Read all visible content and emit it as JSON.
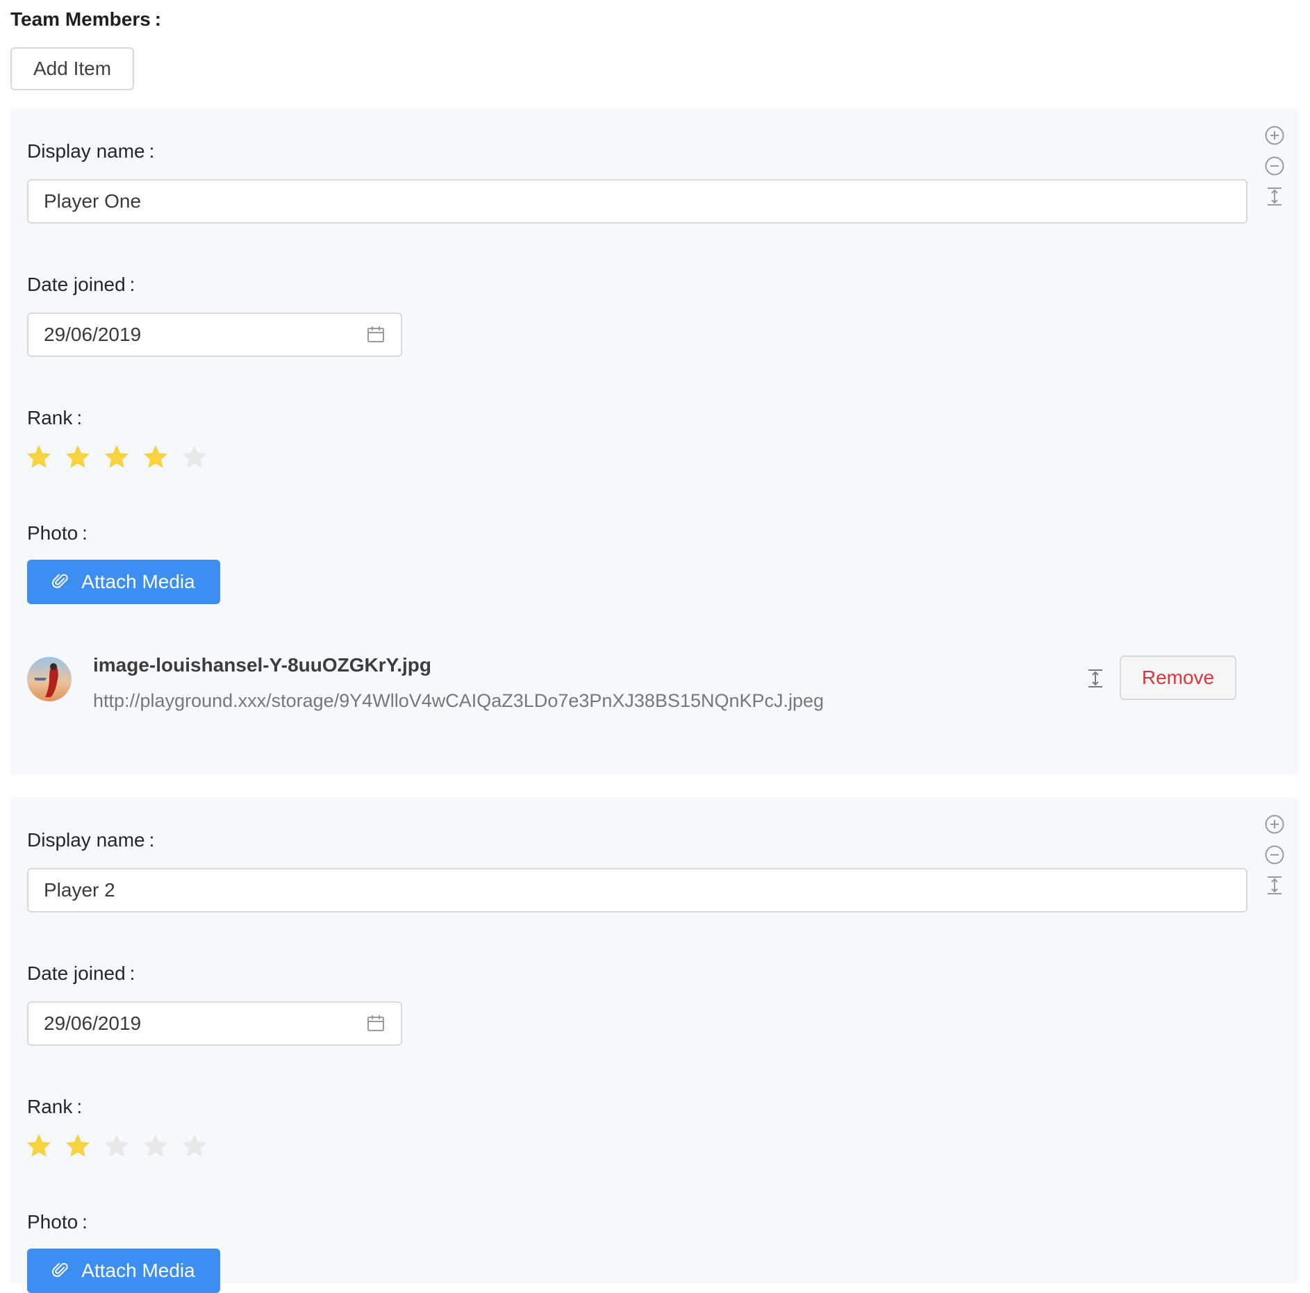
{
  "section": {
    "title": "Team Members",
    "colon": ":"
  },
  "add_item_label": "Add Item",
  "labels": {
    "display_name": "Display name",
    "date_joined": "Date joined",
    "rank": "Rank",
    "photo": "Photo",
    "colon": ":"
  },
  "attach_label": "Attach Media",
  "remove_label": "Remove",
  "members": [
    {
      "display_name": "Player One",
      "date_joined": "29/06/2019",
      "rank": 4,
      "rank_max": 5,
      "photo": {
        "file_name": "image-louishansel-Y-8uuOZGKrY.jpg",
        "url": "http://playground.xxx/storage/9Y4WlloV4wCAIQaZ3LDo7e3PnXJ38BS15NQnKPcJ.jpeg"
      }
    },
    {
      "display_name": "Player 2",
      "date_joined": "29/06/2019",
      "rank": 2,
      "rank_max": 5
    }
  ],
  "colors": {
    "primary": "#3c8ff1",
    "star_on": "#f7d33f",
    "star_off": "#e8e8e8",
    "danger": "#d9363e",
    "card_bg": "#f6f9fc"
  },
  "icons": {
    "add": "plus-circle-icon",
    "remove": "minus-circle-icon",
    "move": "column-height-icon",
    "calendar": "calendar-icon",
    "attach": "paperclip-icon",
    "star": "star-icon"
  }
}
